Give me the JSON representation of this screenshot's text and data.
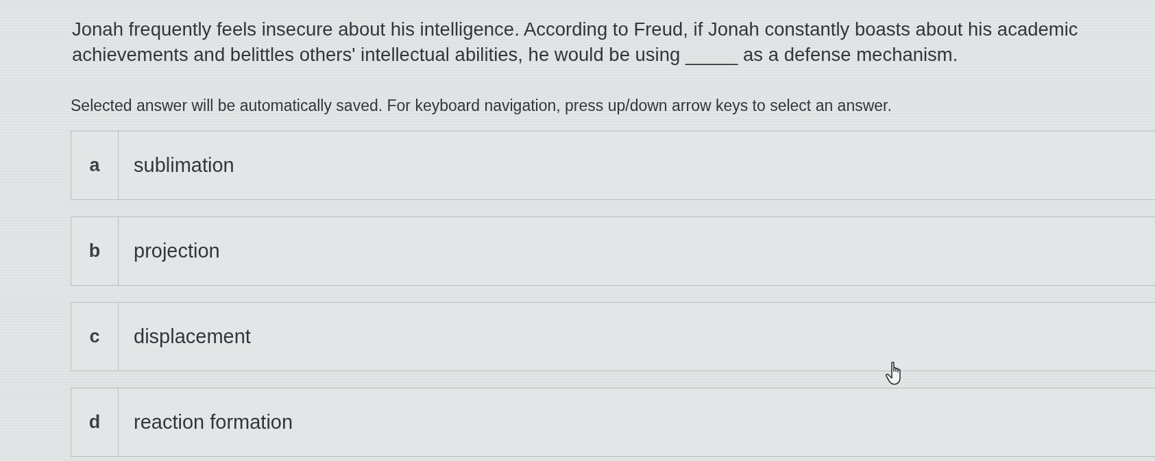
{
  "question": {
    "text": "Jonah frequently feels insecure about his intelligence. According to Freud, if Jonah constantly boasts about his academic achievements and belittles others' intellectual abilities, he would be using _____ as a defense mechanism."
  },
  "instructions": "Selected answer will be automatically saved. For keyboard navigation, press up/down arrow keys to select an answer.",
  "options": [
    {
      "letter": "a",
      "text": "sublimation",
      "selected": false
    },
    {
      "letter": "b",
      "text": "projection",
      "selected": false
    },
    {
      "letter": "c",
      "text": "displacement",
      "selected": false
    },
    {
      "letter": "d",
      "text": "reaction formation",
      "selected": false
    }
  ]
}
